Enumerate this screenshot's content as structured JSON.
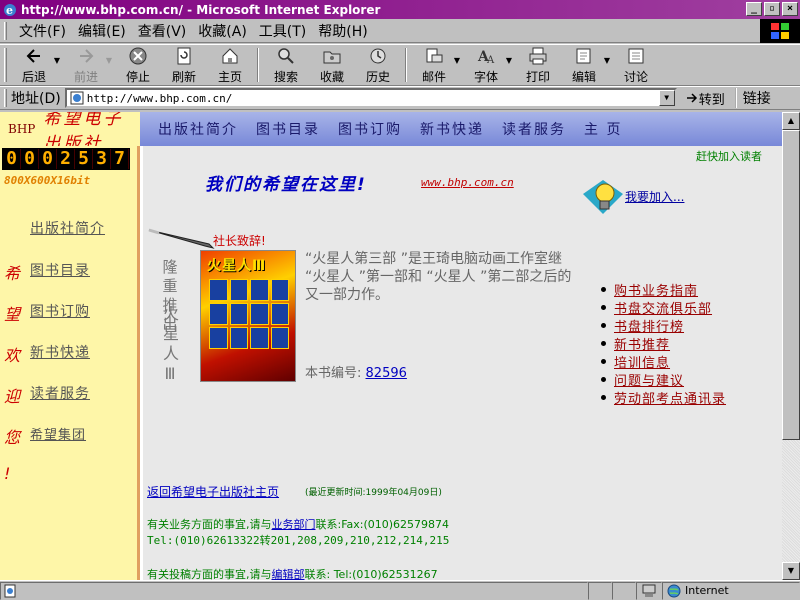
{
  "window": {
    "title": "http://www.bhp.com.cn/ - Microsoft Internet Explorer",
    "min": "_",
    "max": "▫",
    "close": "×"
  },
  "menu": [
    "文件(F)",
    "编辑(E)",
    "查看(V)",
    "收藏(A)",
    "工具(T)",
    "帮助(H)"
  ],
  "toolbar": {
    "back": "后退",
    "forward": "前进",
    "stop": "停止",
    "refresh": "刷新",
    "home": "主页",
    "search": "搜索",
    "favorites": "收藏",
    "history": "历史",
    "mail": "邮件",
    "fonts": "字体",
    "print": "打印",
    "edit": "编辑",
    "discuss": "讨论"
  },
  "address": {
    "label": "地址(D)",
    "url": "http://www.bhp.com.cn/",
    "go": "转到",
    "links": "链接"
  },
  "status": {
    "text": "",
    "zone": "Internet"
  },
  "site": {
    "bhp": "BHP",
    "name": "希望电子出版社",
    "topnav": [
      "出版社简介",
      "图书目录",
      "图书订购",
      "新书快递",
      "读者服务",
      "主 页"
    ],
    "counter": [
      "0",
      "0",
      "0",
      "2",
      "5",
      "3",
      "7"
    ],
    "resolution": "800X600X16bit",
    "sidebar_links": [
      "出版社简介",
      "图书目录",
      "图书订购",
      "新书快递",
      "读者服务",
      "希望集团"
    ],
    "sidebar_chars": [
      "希",
      "望",
      "欢",
      "迎",
      "您",
      "!"
    ],
    "join_reader": "赶快加入读者",
    "slogan": "我们的希望在这里!",
    "slogan_url": "www.bhp.com.cn",
    "want_join": "我要加入...",
    "president": "社长致辞!",
    "recommend": "隆重推出",
    "book_vertical": "火星人Ⅲ",
    "book_cover_title": "火星人Ⅲ",
    "book_desc": "“火星人第三部 ”是王琦电脑动画工作室继 “火星人 ”第一部和 “火星人 ”第二部之后的又一部力作。",
    "book_no_label": "本书编号:",
    "book_no": "82596",
    "right_links": [
      "购书业务指南",
      "书盘交流俱乐部",
      "书盘排行榜",
      "新书推荐",
      "培训信息",
      "问题与建议",
      "劳动部考点通讯录"
    ],
    "back_home": "返回希望电子出版社主页",
    "updated": "(最近更新时间:1999年04月09日)",
    "contact1_pre": "有关业务方面的事宜,请与",
    "contact1_link": "业务部门",
    "contact1_post": "联系:Fax:(010)62579874",
    "contact2": "Tel:(010)62613322转201,208,209,210,212,214,215",
    "contact3_pre": "有关投稿方面的事宜,请与",
    "contact3_link": "编辑部",
    "contact3_post": "联系: Tel:(010)62531267"
  }
}
